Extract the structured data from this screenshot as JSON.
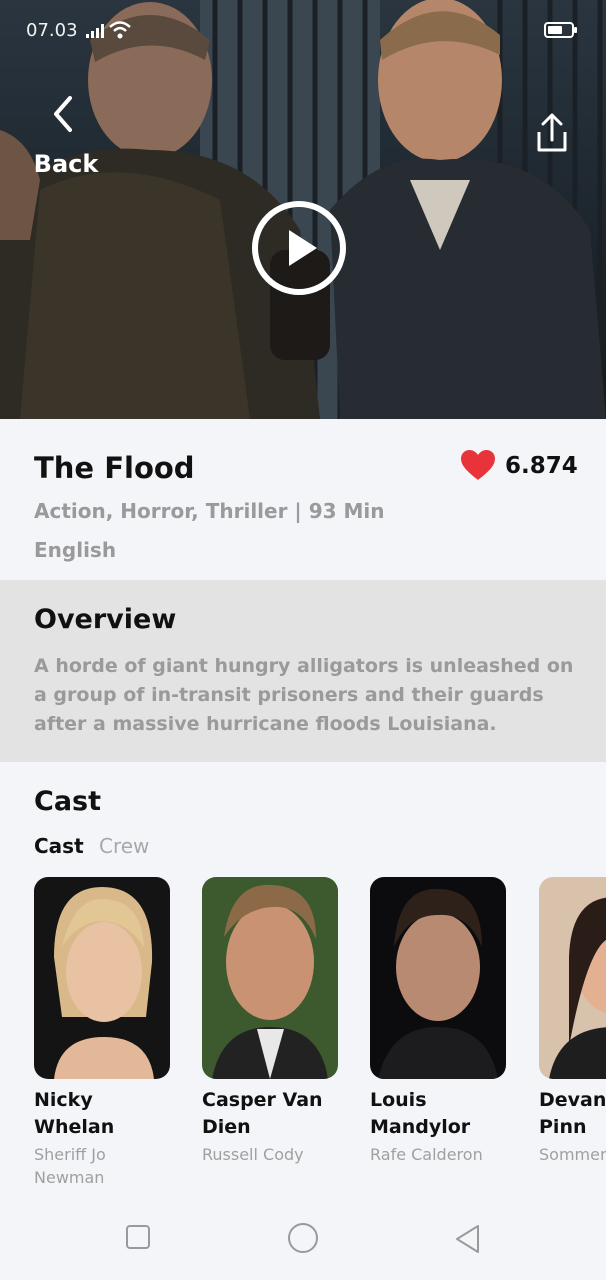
{
  "status_bar": {
    "time": "07.03"
  },
  "header": {
    "back_label": "Back"
  },
  "movie": {
    "title": "The Flood",
    "rating": "6.874",
    "genres_runtime": "Action, Horror, Thriller | 93 Min",
    "language": "English"
  },
  "overview": {
    "heading": "Overview",
    "text": "A horde of giant hungry alligators is unleashed on a group of in-transit prisoners and their guards after a massive hurricane floods Louisiana."
  },
  "cast": {
    "heading": "Cast",
    "tabs": [
      "Cast",
      "Crew"
    ],
    "members": [
      {
        "name": "Nicky Whelan",
        "role": "Sheriff Jo Newman"
      },
      {
        "name": "Casper Van Dien",
        "role": "Russell Cody"
      },
      {
        "name": "Louis Mandylor",
        "role": "Rafe Calderon"
      },
      {
        "name": "Devanny Pinn",
        "role": "Sommer Edward"
      }
    ]
  },
  "colors": {
    "heart": "#e8333a",
    "overview_bg": "#e3e3e3",
    "page_bg": "#f4f5f9"
  },
  "icons": [
    "signal-icon",
    "wifi-icon",
    "battery-icon",
    "back-chevron-icon",
    "share-icon",
    "play-icon",
    "heart-icon",
    "square-nav-icon",
    "circle-nav-icon",
    "triangle-back-nav-icon"
  ]
}
